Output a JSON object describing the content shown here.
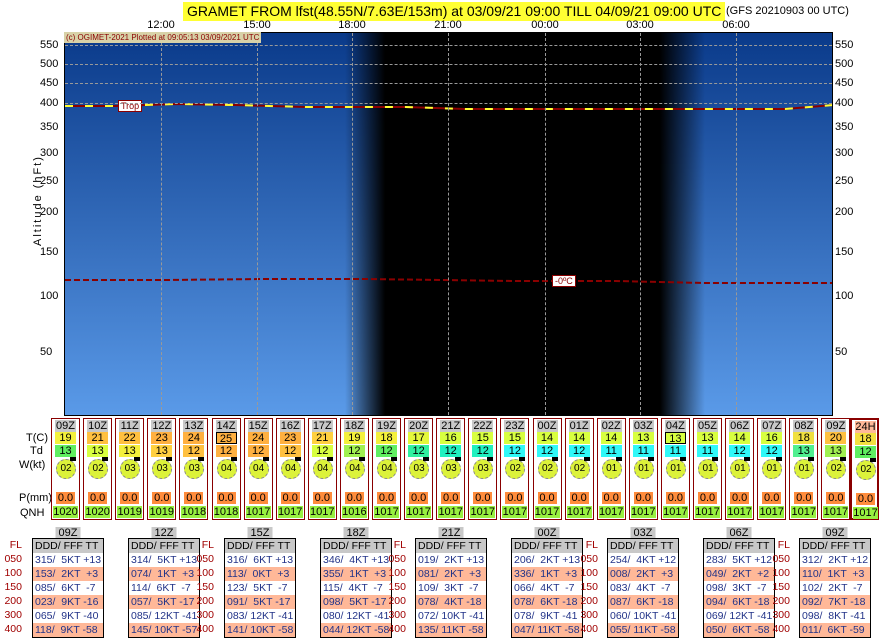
{
  "header": {
    "title": "GRAMET FROM lfst(48.55N/7.63E/153m) at 03/09/21 09:00   TILL  04/09/21 09:00 UTC",
    "model": "(GFS 20210903 00 UTC)",
    "credit": "(c) OGIMET-2021 Plotted at 09:05:13 03/09/2021 UTC"
  },
  "time_axis": [
    "12:00",
    "15:00",
    "18:00",
    "21:00",
    "00:00",
    "03:00",
    "06:00"
  ],
  "y_axis": {
    "title": "Altitude (hFt)",
    "ticks": [
      "550",
      "500",
      "450",
      "400",
      "350",
      "300",
      "250",
      "200",
      "150",
      "100",
      "50"
    ]
  },
  "labels": {
    "trop": "Trop",
    "freezing": "-0ºC"
  },
  "row_labels": {
    "t": "T(C)",
    "td": "Td",
    "w": "W(kt)",
    "p": "P(mm)",
    "qnh": "QNH"
  },
  "columns": [
    {
      "h": "09Z",
      "t": "19",
      "td": "13",
      "w": "02",
      "p": "0.0",
      "q": "1020",
      "tc": "#f4f03c",
      "dc": "#60ee60"
    },
    {
      "h": "10Z",
      "t": "21",
      "td": "13",
      "w": "02",
      "p": "0.0",
      "q": "1020",
      "tc": "#ffc040",
      "dc": "#d8ff40"
    },
    {
      "h": "11Z",
      "t": "22",
      "td": "13",
      "w": "03",
      "p": "0.0",
      "q": "1019",
      "tc": "#ffc040",
      "dc": "#f4f03c"
    },
    {
      "h": "12Z",
      "t": "23",
      "td": "13",
      "w": "03",
      "p": "0.0",
      "q": "1019",
      "tc": "#ffb040",
      "dc": "#ffd040"
    },
    {
      "h": "13Z",
      "t": "24",
      "td": "12",
      "w": "03",
      "p": "0.0",
      "q": "1018",
      "tc": "#ffb040",
      "dc": "#ffc040"
    },
    {
      "h": "14Z",
      "t": "25",
      "td": "12",
      "w": "04",
      "p": "0.0",
      "q": "1018",
      "tc": "#ffb040",
      "dc": "#ffb040",
      "box": true
    },
    {
      "h": "15Z",
      "t": "24",
      "td": "12",
      "w": "04",
      "p": "0.0",
      "q": "1017",
      "tc": "#ffb040",
      "dc": "#ffb040"
    },
    {
      "h": "16Z",
      "t": "23",
      "td": "12",
      "w": "04",
      "p": "0.0",
      "q": "1017",
      "tc": "#ffb040",
      "dc": "#ffc040"
    },
    {
      "h": "17Z",
      "t": "21",
      "td": "12",
      "w": "04",
      "p": "0.0",
      "q": "1017",
      "tc": "#ffd040",
      "dc": "#d8ff40"
    },
    {
      "h": "18Z",
      "t": "19",
      "td": "12",
      "w": "04",
      "p": "0.0",
      "q": "1016",
      "tc": "#f4f03c",
      "dc": "#a0f050"
    },
    {
      "h": "19Z",
      "t": "18",
      "td": "12",
      "w": "04",
      "p": "0.0",
      "q": "1017",
      "tc": "#f4f03c",
      "dc": "#60ee60"
    },
    {
      "h": "20Z",
      "t": "17",
      "td": "12",
      "w": "03",
      "p": "0.0",
      "q": "1017",
      "tc": "#e4f83c",
      "dc": "#30f0a0"
    },
    {
      "h": "21Z",
      "t": "16",
      "td": "12",
      "w": "03",
      "p": "0.0",
      "q": "1017",
      "tc": "#d8ff40",
      "dc": "#20f0c0"
    },
    {
      "h": "22Z",
      "t": "15",
      "td": "12",
      "w": "03",
      "p": "0.0",
      "q": "1017",
      "tc": "#d8ff40",
      "dc": "#20f0c0"
    },
    {
      "h": "23Z",
      "t": "15",
      "td": "12",
      "w": "02",
      "p": "0.0",
      "q": "1017",
      "tc": "#d8ff40",
      "dc": "#30f8f8"
    },
    {
      "h": "00Z",
      "t": "14",
      "td": "12",
      "w": "02",
      "p": "0.0",
      "q": "1017",
      "tc": "#d8ff40",
      "dc": "#30f8f8"
    },
    {
      "h": "01Z",
      "t": "14",
      "td": "12",
      "w": "02",
      "p": "0.0",
      "q": "1017",
      "tc": "#d8ff40",
      "dc": "#30f8f8"
    },
    {
      "h": "02Z",
      "t": "14",
      "td": "11",
      "w": "01",
      "p": "0.0",
      "q": "1017",
      "tc": "#d8ff40",
      "dc": "#30f8f8"
    },
    {
      "h": "03Z",
      "t": "13",
      "td": "11",
      "w": "01",
      "p": "0.0",
      "q": "1017",
      "tc": "#d8ff40",
      "dc": "#30f8f8"
    },
    {
      "h": "04Z",
      "t": "13",
      "td": "11",
      "w": "01",
      "p": "0.0",
      "q": "1017",
      "tc": "#d8ff40",
      "dc": "#30f8f8",
      "box": true
    },
    {
      "h": "05Z",
      "t": "13",
      "td": "11",
      "w": "01",
      "p": "0.0",
      "q": "1017",
      "tc": "#d8ff40",
      "dc": "#30f8f8"
    },
    {
      "h": "06Z",
      "t": "14",
      "td": "12",
      "w": "01",
      "p": "0.0",
      "q": "1017",
      "tc": "#d8ff40",
      "dc": "#30f8f8"
    },
    {
      "h": "07Z",
      "t": "16",
      "td": "12",
      "w": "01",
      "p": "0.0",
      "q": "1017",
      "tc": "#d8ff40",
      "dc": "#30f8f8"
    },
    {
      "h": "08Z",
      "t": "18",
      "td": "13",
      "w": "01",
      "p": "0.0",
      "q": "1017",
      "tc": "#f0e040",
      "dc": "#50f090"
    },
    {
      "h": "09Z",
      "t": "20",
      "td": "13",
      "w": "02",
      "p": "0.0",
      "q": "1017",
      "tc": "#ffc040",
      "dc": "#a0f050"
    }
  ],
  "summary": {
    "h": "24H",
    "t": "18",
    "td": "12",
    "w": "02",
    "p": "0.0",
    "q": "1017",
    "tc": "#f4e040",
    "dc": "#60ee60"
  },
  "fl_label": "FL",
  "fl_levels": [
    "050",
    "100",
    "150",
    "200",
    "300",
    "400"
  ],
  "table_header": "DDD/ FFF TT",
  "tables": [
    {
      "time": "09Z",
      "rows": [
        "315/  5KT +13",
        "153/  2KT  +3",
        "085/  6KT  -7",
        "023/  9KT -16",
        "065/  9KT -40",
        "118/  9KT -58"
      ]
    },
    {
      "time": "12Z",
      "rows": [
        "314/  5KT +13",
        "074/  1KT  +3",
        "114/  6KT  -7",
        "057/  5KT -17",
        "085/ 12KT -41",
        "145/ 10KT -57"
      ]
    },
    {
      "time": "15Z",
      "rows": [
        "316/  6KT +13",
        "113/  0KT  +3",
        "123/  5KT  -7",
        "091/  5KT -17",
        "083/ 12KT -41",
        "141/ 10KT -58"
      ]
    },
    {
      "time": "18Z",
      "rows": [
        "346/  4KT +13",
        "355/  1KT  +3",
        "115/  4KT  -7",
        "098/  5KT -17",
        "080/ 12KT -41",
        "044/ 12KT -58"
      ]
    },
    {
      "time": "21Z",
      "rows": [
        "019/  2KT +13",
        "081/  2KT  +3",
        "109/  3KT  -7",
        "078/  4KT -18",
        "072/ 10KT -41",
        "135/ 11KT -58"
      ]
    },
    {
      "time": "00Z",
      "rows": [
        "206/  2KT +13",
        "336/  1KT  +3",
        "066/  4KT  -7",
        "078/  6KT -18",
        "078/  9KT -41",
        "047/ 11KT -58"
      ]
    },
    {
      "time": "03Z",
      "rows": [
        "254/  4KT +12",
        "008/  2KT  +3",
        "083/  4KT  -7",
        "087/  6KT -18",
        "060/ 10KT -41",
        "055/ 11KT -58"
      ]
    },
    {
      "time": "06Z",
      "rows": [
        "283/  5KT +12",
        "049/  2KT  +2",
        "098/  3KT  -7",
        "094/  6KT -18",
        "069/ 12KT -41",
        "050/  6KT -58"
      ]
    },
    {
      "time": "09Z",
      "rows": [
        "312/  2KT +12",
        "110/  1KT  +3",
        "102/  2KT  -7",
        "092/  7KT -18",
        "098/  8KT -41",
        "011/  6KT -59"
      ]
    }
  ]
}
